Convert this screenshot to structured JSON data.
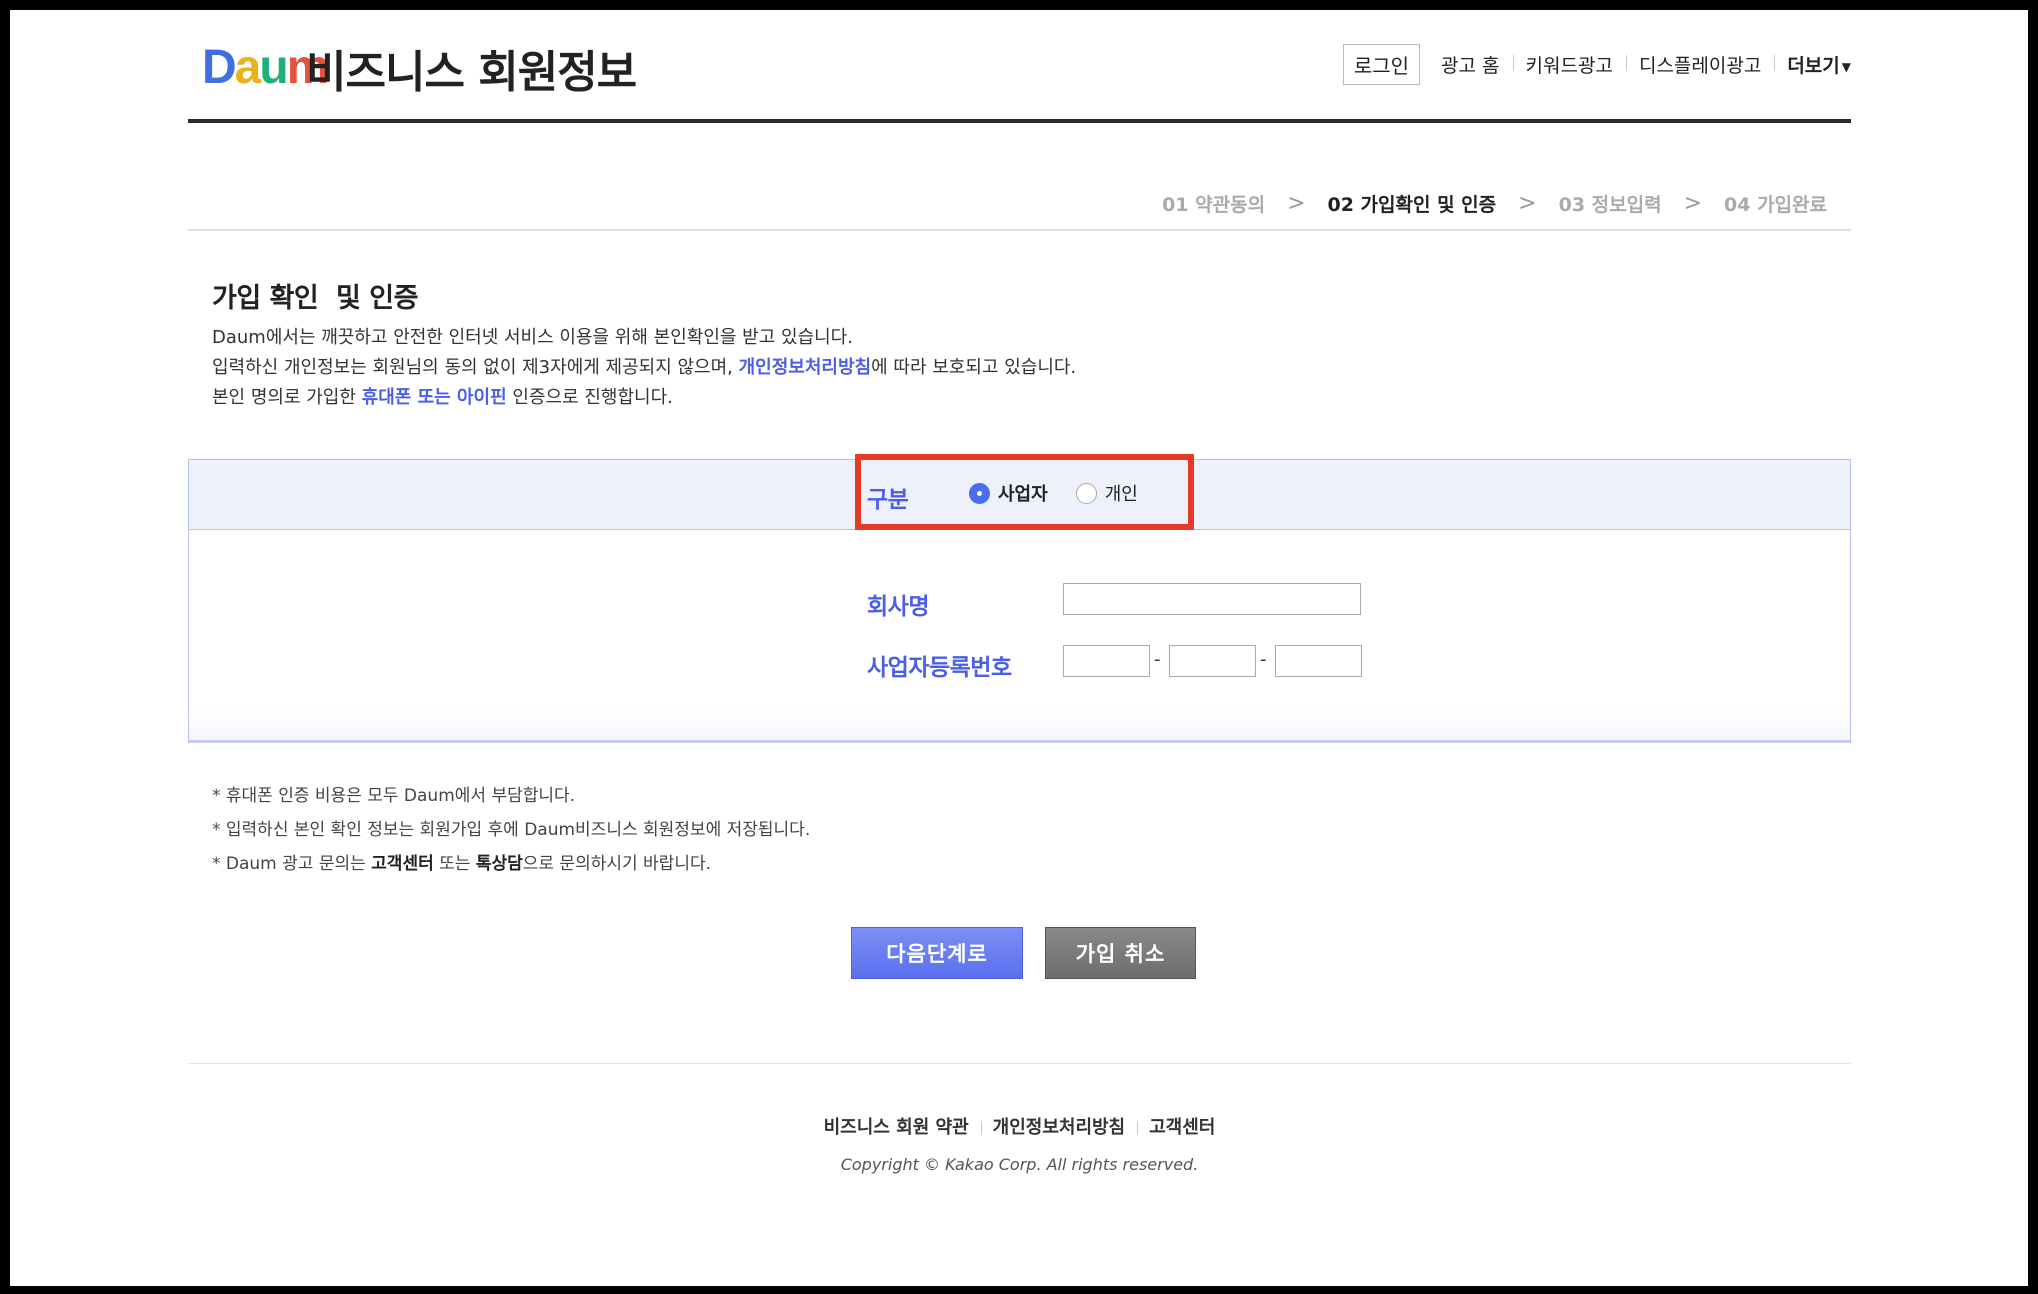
{
  "logo": {
    "letters": [
      "D",
      "a",
      "u",
      "m"
    ],
    "colors": [
      "#3f6fe0",
      "#e8b21f",
      "#1fb07a",
      "#e5533e"
    ]
  },
  "header": {
    "title": "비즈니스 회원정보",
    "login": "로그인",
    "nav": [
      "광고 홈",
      "키워드광고",
      "디스플레이광고"
    ],
    "more": "더보기",
    "more_icon": "caret-down"
  },
  "steps": [
    {
      "label": "01 약관동의",
      "active": false
    },
    {
      "label": "02 가입확인 및 인증",
      "active": true
    },
    {
      "label": "03 정보입력",
      "active": false
    },
    {
      "label": "04 가입완료",
      "active": false
    }
  ],
  "steps_separator": ">",
  "main": {
    "heading": "가입 확인  및 인증",
    "desc": {
      "line1": "Daum에서는 깨끗하고 안전한 인터넷 서비스 이용을 위해 본인확인을 받고 있습니다.",
      "line2_a": "입력하신 개인정보는 회원님의 동의 없이 제3자에게 제공되지 않으며, ",
      "line2_link": "개인정보처리방침",
      "line2_b": "에 따라 보호되고 있습니다.",
      "line3_a": "본인 명의로 가입한 ",
      "line3_link": "휴대폰 또는 아이핀",
      "line3_b": " 인증으로 진행합니다."
    }
  },
  "form": {
    "type_label": "구분",
    "options": [
      {
        "label": "사업자",
        "checked": true
      },
      {
        "label": "개인",
        "checked": false
      }
    ],
    "company_label": "회사명",
    "company_value": "",
    "bizno_label": "사업자등록번호",
    "bizno_values": [
      "",
      "",
      ""
    ],
    "bizno_separator": "-"
  },
  "notes": {
    "n1": "* 휴대폰 인증 비용은 모두 Daum에서 부담합니다.",
    "n2": "* 입력하신 본인 확인 정보는 회원가입 후에 Daum비즈니스 회원정보에 저장됩니다.",
    "n3_a": "* Daum 광고 문의는 ",
    "n3_b1": "고객센터",
    "n3_mid": " 또는 ",
    "n3_b2": "톡상담",
    "n3_c": "으로 문의하시기 바랍니다."
  },
  "buttons": {
    "next": "다음단계로",
    "cancel": "가입 취소"
  },
  "footer": {
    "links": [
      "비즈니스 회원 약관",
      "개인정보처리방침",
      "고객센터"
    ],
    "copyright": "Copyright © Kakao Corp. All rights reserved."
  },
  "colors": {
    "accent": "#4a5ee8",
    "highlight": "#e53a26"
  }
}
